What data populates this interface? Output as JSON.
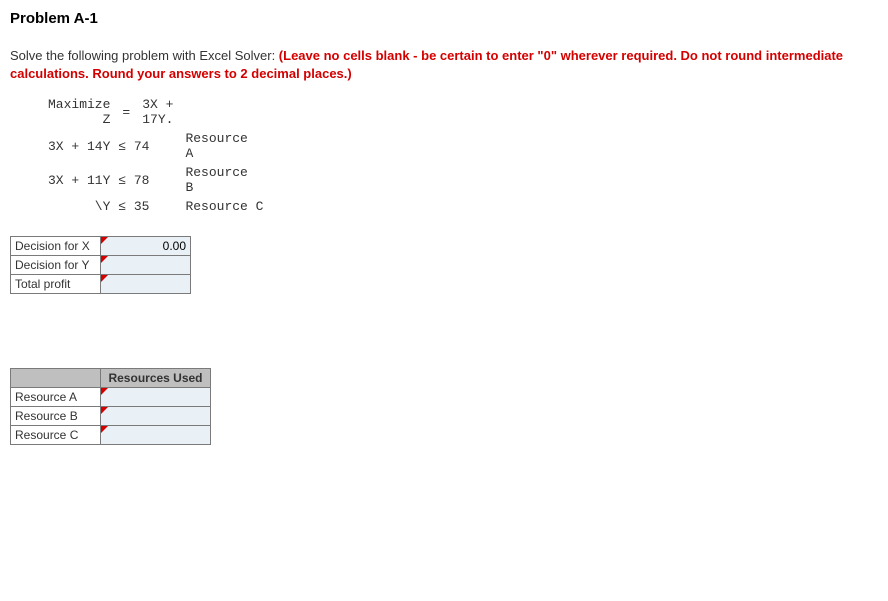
{
  "title": "Problem A-1",
  "intro_plain": "Solve the following problem with Excel Solver: ",
  "intro_warn": "(Leave no cells blank - be certain to enter \"0\" wherever required. Do not round intermediate calculations. Round your answers to 2 decimal places.)",
  "lp": {
    "obj_left": "Maximize\n       Z",
    "obj_eq": "=",
    "obj_right": "3X +\n17Y.",
    "c1_lhs": "3X + 14Y ≤ 74",
    "c1_label": "Resource\nA",
    "c2_lhs": "3X + 11Y ≤ 78",
    "c2_label": "Resource\nB",
    "c3_lhs": "      \\Y ≤ 35",
    "c3_label": "Resource C"
  },
  "decision_table": {
    "rows": [
      {
        "label": "Decision for X",
        "value": "0.00"
      },
      {
        "label": "Decision for Y",
        "value": ""
      },
      {
        "label": "Total profit",
        "value": ""
      }
    ]
  },
  "resources_table": {
    "header": "Resources Used",
    "rows": [
      {
        "label": "Resource A",
        "value": ""
      },
      {
        "label": "Resource B",
        "value": ""
      },
      {
        "label": "Resource C",
        "value": ""
      }
    ]
  }
}
